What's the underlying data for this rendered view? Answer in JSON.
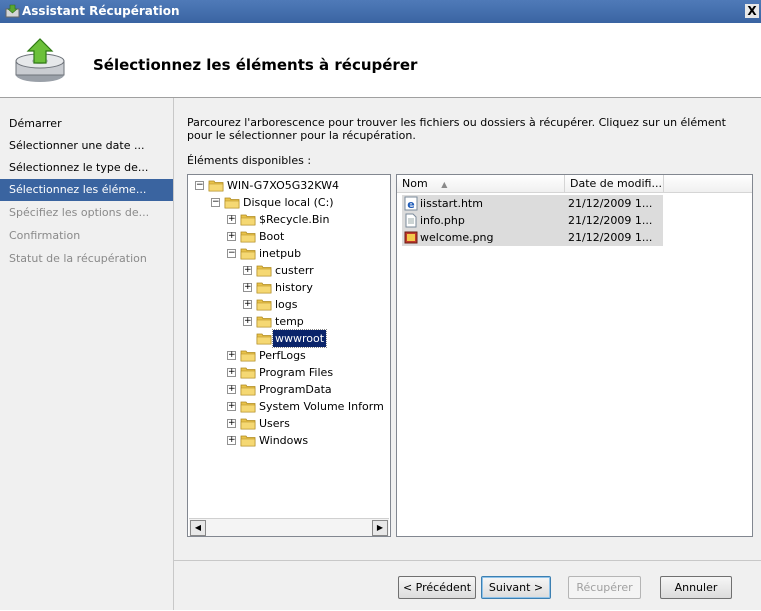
{
  "window": {
    "title": "Assistant Récupération",
    "close_glyph": "X"
  },
  "header": {
    "page_title": "Sélectionnez les éléments à récupérer"
  },
  "steps": [
    {
      "label": "Démarrer",
      "state": "done"
    },
    {
      "label": "Sélectionner une date ...",
      "state": "done"
    },
    {
      "label": "Sélectionnez le type de...",
      "state": "done"
    },
    {
      "label": "Sélectionnez les éléme...",
      "state": "active"
    },
    {
      "label": "Spécifiez les options de...",
      "state": "pending"
    },
    {
      "label": "Confirmation",
      "state": "pending"
    },
    {
      "label": "Statut de la récupération",
      "state": "pending"
    }
  ],
  "main": {
    "instructions": "Parcourez l'arborescence pour trouver les fichiers ou dossiers à récupérer. Cliquez sur un élément pour le sélectionner pour la récupération.",
    "available_label": "Éléments disponibles :"
  },
  "tree": [
    {
      "label": "WIN-G7XO5G32KW4",
      "level": 0,
      "expander": "minus"
    },
    {
      "label": "Disque local (C:)",
      "level": 1,
      "expander": "minus"
    },
    {
      "label": "$Recycle.Bin",
      "level": 2,
      "expander": "plus"
    },
    {
      "label": "Boot",
      "level": 2,
      "expander": "plus"
    },
    {
      "label": "inetpub",
      "level": 2,
      "expander": "minus"
    },
    {
      "label": "custerr",
      "level": 3,
      "expander": "plus"
    },
    {
      "label": "history",
      "level": 3,
      "expander": "plus"
    },
    {
      "label": "logs",
      "level": 3,
      "expander": "plus"
    },
    {
      "label": "temp",
      "level": 3,
      "expander": "plus"
    },
    {
      "label": "wwwroot",
      "level": 3,
      "expander": "none",
      "selected": true
    },
    {
      "label": "PerfLogs",
      "level": 2,
      "expander": "plus"
    },
    {
      "label": "Program Files",
      "level": 2,
      "expander": "plus"
    },
    {
      "label": "ProgramData",
      "level": 2,
      "expander": "plus"
    },
    {
      "label": "System Volume Inform",
      "level": 2,
      "expander": "plus"
    },
    {
      "label": "Users",
      "level": 2,
      "expander": "plus"
    },
    {
      "label": "Windows",
      "level": 2,
      "expander": "plus"
    }
  ],
  "file_list": {
    "columns": [
      {
        "label": "Nom",
        "sort_glyph": "▲"
      },
      {
        "label": "Date de modifi..."
      }
    ],
    "rows": [
      {
        "name": "iisstart.htm",
        "date": "21/12/2009 1...",
        "icon": "html-file-icon"
      },
      {
        "name": "info.php",
        "date": "21/12/2009 1...",
        "icon": "document-file-icon"
      },
      {
        "name": "welcome.png",
        "date": "21/12/2009 1...",
        "icon": "image-file-icon"
      }
    ]
  },
  "buttons": {
    "previous": "< Précédent",
    "next": "Suivant >",
    "recover": "Récupérer",
    "cancel": "Annuler"
  },
  "colors": {
    "titlebar": "#3a64a2",
    "active_step": "#3a64a0",
    "selection": "#0a246a",
    "folder": "#e8c24a"
  }
}
